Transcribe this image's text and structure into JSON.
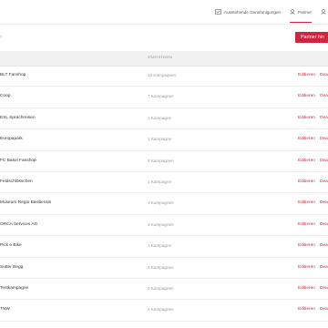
{
  "nav": {
    "approvals_label": "Ausstehende Genehmigungen",
    "partner_label": "Partner"
  },
  "toolbar": {
    "add_partner_label": "Partner hin"
  },
  "table": {
    "column_statistics": "STATISTIKEN",
    "rows": [
      {
        "name": "BLT Fanshop",
        "stats": "13 Kampagnen",
        "edit": "Editieren",
        "deactivate": "Dea"
      },
      {
        "name": "Coop",
        "stats": "7 Kampagnen",
        "edit": "Editieren",
        "deactivate": "Dea"
      },
      {
        "name": "ESL Sprachreisen",
        "stats": "1 Kampagne",
        "edit": "Editieren",
        "deactivate": "Dea"
      },
      {
        "name": "Europapark",
        "stats": "1 Kampagne",
        "edit": "Editieren",
        "deactivate": "Dea"
      },
      {
        "name": "FC Basel Fanshop",
        "stats": "3 Kampagnen",
        "edit": "Editieren",
        "deactivate": "Dea"
      },
      {
        "name": "Feldschlösschen",
        "stats": "1 Kampagne",
        "edit": "Editieren",
        "deactivate": "Dea"
      },
      {
        "name": "Museum Regio Basiliensis",
        "stats": "3 Kampagnen",
        "edit": "Editieren",
        "deactivate": "Dea"
      },
      {
        "name": "ORCA Services AG",
        "stats": "4 Kampagnen",
        "edit": "Editieren",
        "deactivate": "Dea"
      },
      {
        "name": "Pick e Bike",
        "stats": "1 Kampagne",
        "edit": "Editieren",
        "deactivate": "Dea"
      },
      {
        "name": "Sutter Begg",
        "stats": "2 Kampagnen",
        "edit": "Editieren",
        "deactivate": "Dea"
      },
      {
        "name": "Testkampagne",
        "stats": "0 Kampagnen",
        "edit": "Editieren",
        "deactivate": "Dea"
      },
      {
        "name": "TNW",
        "stats": "4 Kampagnen",
        "edit": "Editieren",
        "deactivate": "Dea"
      }
    ]
  },
  "colors": {
    "accent": "#d2233f",
    "header_bg": "#f1f1f1"
  }
}
